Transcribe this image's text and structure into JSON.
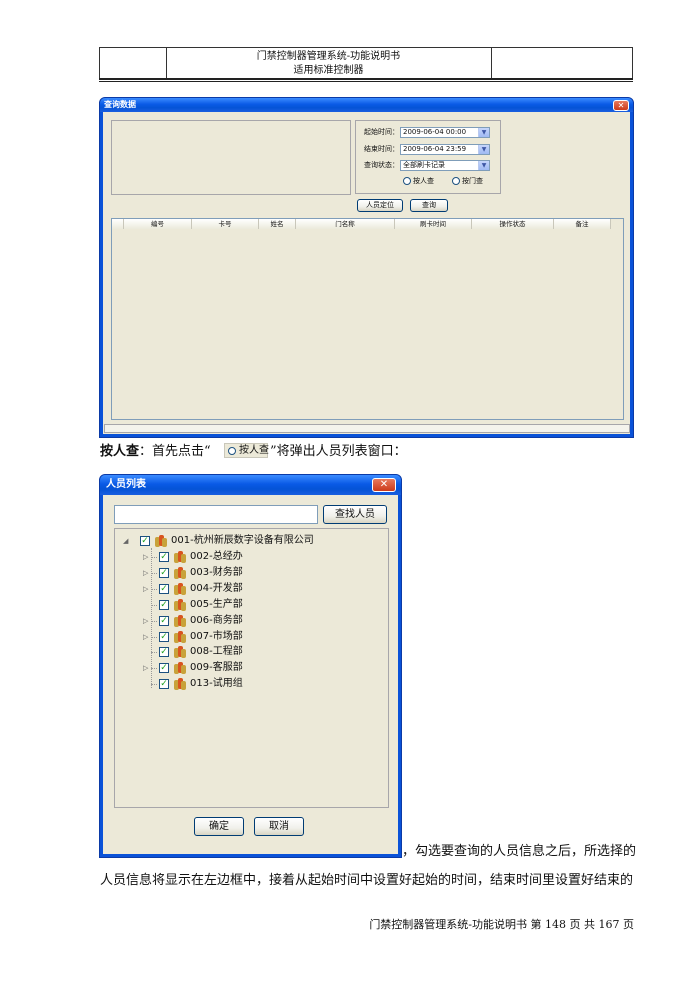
{
  "header": {
    "title_line1": "门禁控制器管理系统-功能说明书",
    "title_line2": "适用标准控制器"
  },
  "query_window": {
    "title": "查询数据",
    "close": "✕",
    "start_label": "起始时间：",
    "start_value": "2009-06-04 00:00",
    "end_label": "结束时间：",
    "end_value": "2009-06-04 23:59",
    "status_label": "查询状态：",
    "status_value": "全部刷卡记录",
    "radio_person": "按人查",
    "radio_door": "按门查",
    "btn_locate": "人员定位",
    "btn_query": "查询",
    "columns": [
      "编号",
      "卡号",
      "姓名",
      "门名称",
      "刷卡时间",
      "操作状态",
      "备注"
    ]
  },
  "para1": {
    "bold": "按人查",
    "text_before": "：首先点击“",
    "inline_button": "按人查",
    "text_after": "”将弹出人员列表窗口："
  },
  "person_window": {
    "title": "人员列表",
    "close": "✕",
    "search_value": "",
    "btn_find": "查找人员",
    "root": "001-杭州新辰数字设备有限公司",
    "departments": [
      {
        "label": "002-总经办",
        "expandable": true
      },
      {
        "label": "003-财务部",
        "expandable": true
      },
      {
        "label": "004-开发部",
        "expandable": true
      },
      {
        "label": "005-生产部",
        "expandable": false
      },
      {
        "label": "006-商务部",
        "expandable": true
      },
      {
        "label": "007-市场部",
        "expandable": true
      },
      {
        "label": "008-工程部",
        "expandable": false
      },
      {
        "label": "009-客服部",
        "expandable": true
      },
      {
        "label": "013-试用组",
        "expandable": false
      }
    ],
    "btn_ok": "确定",
    "btn_cancel": "取消"
  },
  "para2_line1": "，勾选要查询的人员信息之后，所选择的",
  "para2_line2": "人员信息将显示在左边框中，接着从起始时间中设置好起始的时间，结束时间里设置好结束的",
  "footer": "门禁控制器管理系统-功能说明书  第 148 页 共 167 页",
  "colors": {
    "xp_blue": "#0a52d8",
    "dialog_bg": "#ece9d8",
    "check_green": "#21a121",
    "close_red": "#cc3a1a"
  }
}
